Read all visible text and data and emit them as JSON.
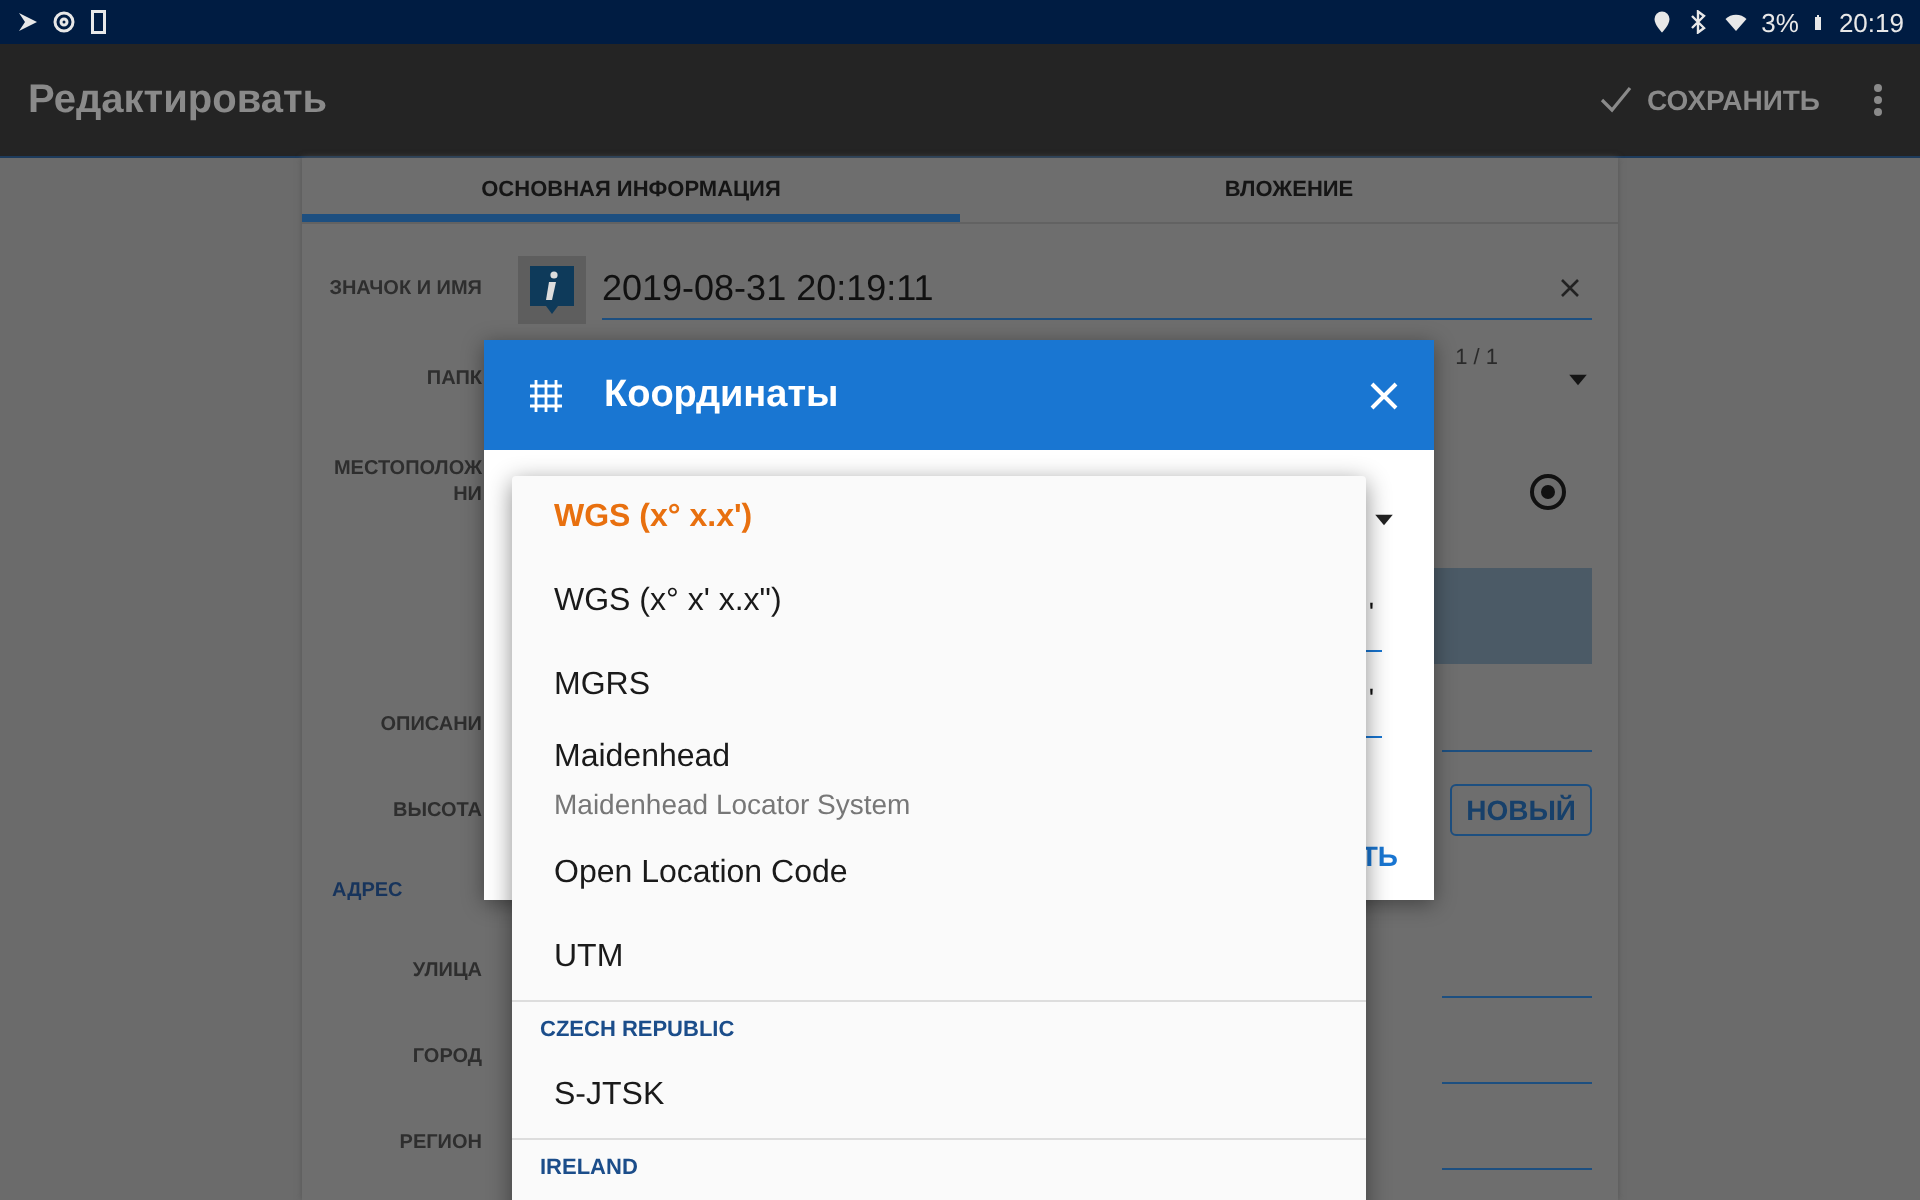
{
  "status_bar": {
    "battery": "3%",
    "time": "20:19"
  },
  "app_bar": {
    "title": "Редактировать",
    "save": "СОХРАНИТЬ"
  },
  "tabs": [
    {
      "label": "ОСНОВНАЯ ИНФОРМАЦИЯ",
      "selected": true
    },
    {
      "label": "ВЛОЖЕНИЕ",
      "selected": false
    }
  ],
  "form": [
    {
      "kind": "name",
      "label": "ЗНАЧОК И ИМЯ",
      "value": "2019-08-31 20:19:11"
    },
    {
      "kind": "folder",
      "label": "ПАПК",
      "counter": "1 / 1"
    },
    {
      "kind": "location",
      "label": "МЕСТОПОЛОЖ НИ"
    },
    {
      "kind": "text",
      "label": "ОПИСАНИ"
    },
    {
      "kind": "altitude",
      "label": "ВЫСОТА",
      "button": "НОВЫЙ"
    },
    {
      "kind": "section",
      "label": "АДРЕС"
    },
    {
      "kind": "text",
      "label": "УЛИЦА"
    },
    {
      "kind": "text",
      "label": "ГОРОД"
    },
    {
      "kind": "text",
      "label": "РЕГИОН"
    }
  ],
  "dialog": {
    "title": "Координаты",
    "coords": [
      "'",
      "'"
    ],
    "button": "ТЬ"
  },
  "menu": [
    {
      "kind": "item",
      "label": "WGS (x° x.x')",
      "selected": true
    },
    {
      "kind": "item",
      "label": "WGS (x° x' x.x\")",
      "selected": false
    },
    {
      "kind": "item",
      "label": "MGRS",
      "selected": false
    },
    {
      "kind": "item",
      "label": "Maidenhead",
      "subtitle": "Maidenhead Locator System",
      "selected": false
    },
    {
      "kind": "item",
      "label": "Open Location Code",
      "selected": false
    },
    {
      "kind": "item",
      "label": "UTM",
      "selected": false
    },
    {
      "kind": "header",
      "label": "CZECH REPUBLIC"
    },
    {
      "kind": "item",
      "label": "S-JTSK",
      "selected": false
    },
    {
      "kind": "header",
      "label": "IRELAND"
    }
  ]
}
